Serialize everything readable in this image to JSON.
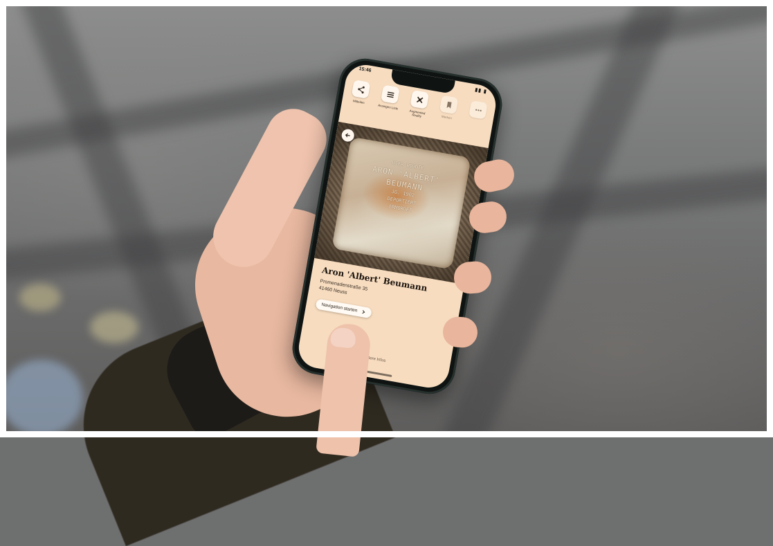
{
  "status_bar": {
    "time": "15:46",
    "icons": "▮▮ ▮"
  },
  "toolbar": [
    {
      "label": "Mitteilen",
      "icon": "share-icon"
    },
    {
      "label": "Anzeigen Liste",
      "icon": "list-icon"
    },
    {
      "label": "Augmented Reality",
      "icon": "ar-icon"
    },
    {
      "label": "Merken",
      "icon": "bookmark-icon"
    },
    {
      "label": "",
      "icon": "more-icon"
    }
  ],
  "stone": {
    "engraving": [
      "HIER WOHNTE",
      "ARON 'ALBERT'",
      "BEUMANN",
      "JG. 1902",
      "DEPORTIERT",
      "ERMORDET"
    ]
  },
  "detail": {
    "name": "Aron 'Albert' Beumann",
    "street": "Promenadenstraße 35",
    "city": "41460 Neuss",
    "navigation_label": "Navigation starten",
    "more_label": "Weitere Infos"
  },
  "colors": {
    "screen_bg": "#f7dcbf",
    "accent_brass": "#c7b095"
  }
}
